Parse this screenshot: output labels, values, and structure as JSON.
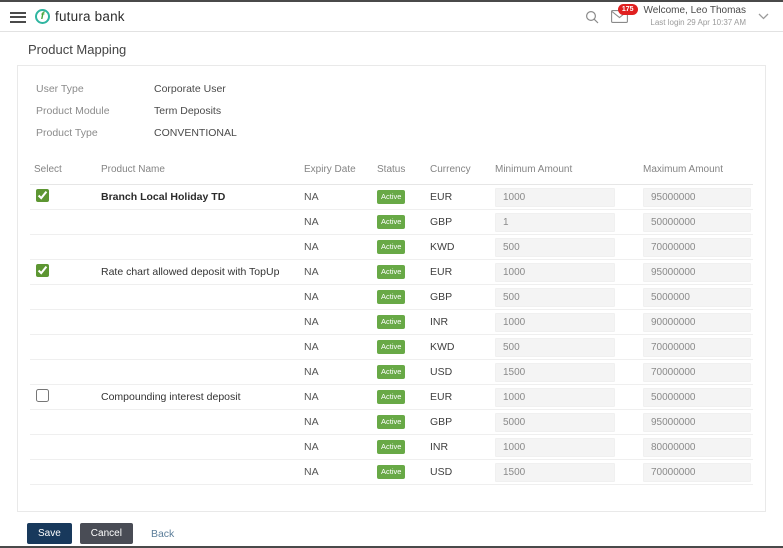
{
  "header": {
    "brand": "futura bank",
    "mail_count": "175",
    "welcome": "Welcome, Leo Thomas",
    "last_login": "Last login 29 Apr 10:37 AM"
  },
  "page": {
    "title": "Product Mapping"
  },
  "details": {
    "user_type_label": "User Type",
    "user_type_value": "Corporate User",
    "product_module_label": "Product Module",
    "product_module_value": "Term Deposits",
    "product_type_label": "Product Type",
    "product_type_value": "CONVENTIONAL"
  },
  "table": {
    "headers": {
      "select": "Select",
      "product_name": "Product Name",
      "expiry_date": "Expiry Date",
      "status": "Status",
      "currency": "Currency",
      "min": "Minimum Amount",
      "max": "Maximum Amount"
    },
    "rows": [
      {
        "checked": true,
        "product_name": "Branch Local Holiday TD",
        "expiry_date": "NA",
        "status": "Active",
        "currency": "EUR",
        "min_amount": "1000",
        "max_amount": "95000000"
      },
      {
        "product_name": "",
        "expiry_date": "NA",
        "status": "Active",
        "currency": "GBP",
        "min_amount": "1",
        "max_amount": "50000000"
      },
      {
        "product_name": "",
        "expiry_date": "NA",
        "status": "Active",
        "currency": "KWD",
        "min_amount": "500",
        "max_amount": "70000000"
      },
      {
        "checked": true,
        "product_name": "Rate chart allowed deposit with TopUp",
        "expiry_date": "NA",
        "status": "Active",
        "currency": "EUR",
        "min_amount": "1000",
        "max_amount": "95000000"
      },
      {
        "product_name": "",
        "expiry_date": "NA",
        "status": "Active",
        "currency": "GBP",
        "min_amount": "500",
        "max_amount": "5000000"
      },
      {
        "product_name": "",
        "expiry_date": "NA",
        "status": "Active",
        "currency": "INR",
        "min_amount": "1000",
        "max_amount": "90000000"
      },
      {
        "product_name": "",
        "expiry_date": "NA",
        "status": "Active",
        "currency": "KWD",
        "min_amount": "500",
        "max_amount": "70000000"
      },
      {
        "product_name": "",
        "expiry_date": "NA",
        "status": "Active",
        "currency": "USD",
        "min_amount": "1500",
        "max_amount": "70000000"
      },
      {
        "checked": false,
        "product_name": "Compounding interest deposit",
        "expiry_date": "NA",
        "status": "Active",
        "currency": "EUR",
        "min_amount": "1000",
        "max_amount": "50000000"
      },
      {
        "product_name": "",
        "expiry_date": "NA",
        "status": "Active",
        "currency": "GBP",
        "min_amount": "5000",
        "max_amount": "95000000"
      },
      {
        "product_name": "",
        "expiry_date": "NA",
        "status": "Active",
        "currency": "INR",
        "min_amount": "1000",
        "max_amount": "80000000"
      },
      {
        "product_name": "",
        "expiry_date": "NA",
        "status": "Active",
        "currency": "USD",
        "min_amount": "1500",
        "max_amount": "70000000"
      }
    ]
  },
  "actions": {
    "save": "Save",
    "cancel": "Cancel",
    "back": "Back"
  },
  "colors": {
    "brand_teal": "#2fb5a0",
    "brand_green": "#44a339",
    "badge_red": "#e02020",
    "active_green": "#68a946",
    "checkbox_accent": "#5d9632",
    "input_bg": "#f4f4f4",
    "save_navy": "#18395c",
    "cancel_gray": "#494c55",
    "back_link": "#5c7e9a"
  }
}
